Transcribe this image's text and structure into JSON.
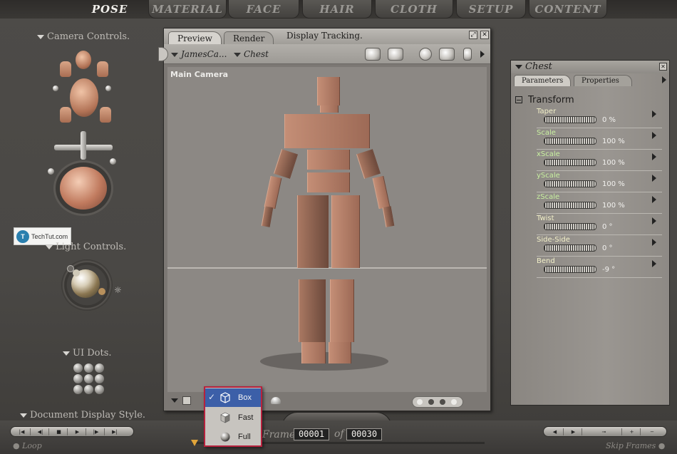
{
  "top_tabs": [
    {
      "label": "POSE"
    },
    {
      "label": "MATERIAL"
    },
    {
      "label": "FACE"
    },
    {
      "label": "HAIR"
    },
    {
      "label": "CLOTH"
    },
    {
      "label": "SETUP"
    },
    {
      "label": "CONTENT"
    }
  ],
  "left_panel": {
    "camera_controls": "Camera Controls.",
    "light_controls": "Light Controls.",
    "ui_dots": "UI Dots.",
    "document_display_style": "Document Display Style.",
    "watermark": "TechTut.com"
  },
  "document_window": {
    "tabs": [
      {
        "label": "Preview"
      },
      {
        "label": "Render"
      }
    ],
    "display_tracking": "Display Tracking.",
    "figure_menu": "JamesCa...",
    "actor_menu": "Chest",
    "camera_label": "Main Camera",
    "resize_icon": "expand-icon",
    "close_icon": "close-icon"
  },
  "display_style_menu": {
    "items": [
      {
        "label": "Box",
        "selected": true,
        "icon": "box-cube-icon"
      },
      {
        "label": "Fast",
        "selected": false,
        "icon": "fast-shaded-cube-icon"
      },
      {
        "label": "Full",
        "selected": false,
        "icon": "full-sphere-icon"
      }
    ],
    "check": "✓"
  },
  "parameter_panel": {
    "title": "Chest",
    "tabs": [
      {
        "label": "Parameters"
      },
      {
        "label": "Properties"
      }
    ],
    "group": "Transform",
    "params": [
      {
        "label": "Taper",
        "value": "0 %",
        "color": "#f2f0c8"
      },
      {
        "label": "Scale",
        "value": "100 %",
        "color": "#c8f0a0"
      },
      {
        "label": "xScale",
        "value": "100 %",
        "color": "#c8f0a0"
      },
      {
        "label": "yScale",
        "value": "100 %",
        "color": "#c8f0a0"
      },
      {
        "label": "zScale",
        "value": "100 %",
        "color": "#c8f0a0"
      },
      {
        "label": "Twist",
        "value": "0 °",
        "color": "#f2f0c8"
      },
      {
        "label": "Side-Side",
        "value": "0 °",
        "color": "#f2f0c8"
      },
      {
        "label": "Bend",
        "value": "-9 °",
        "color": "#f2f0c8"
      }
    ]
  },
  "bottom_bar": {
    "frames_label": "Frames",
    "current_frame": "00001",
    "of_label": "of",
    "total_frames": "00030",
    "loop": "Loop",
    "skip_frames": "Skip Frames"
  },
  "colors": {
    "menu_highlight": "#3c5fa8",
    "menu_border": "#b6213d",
    "figure_skin": "#b07a62"
  }
}
